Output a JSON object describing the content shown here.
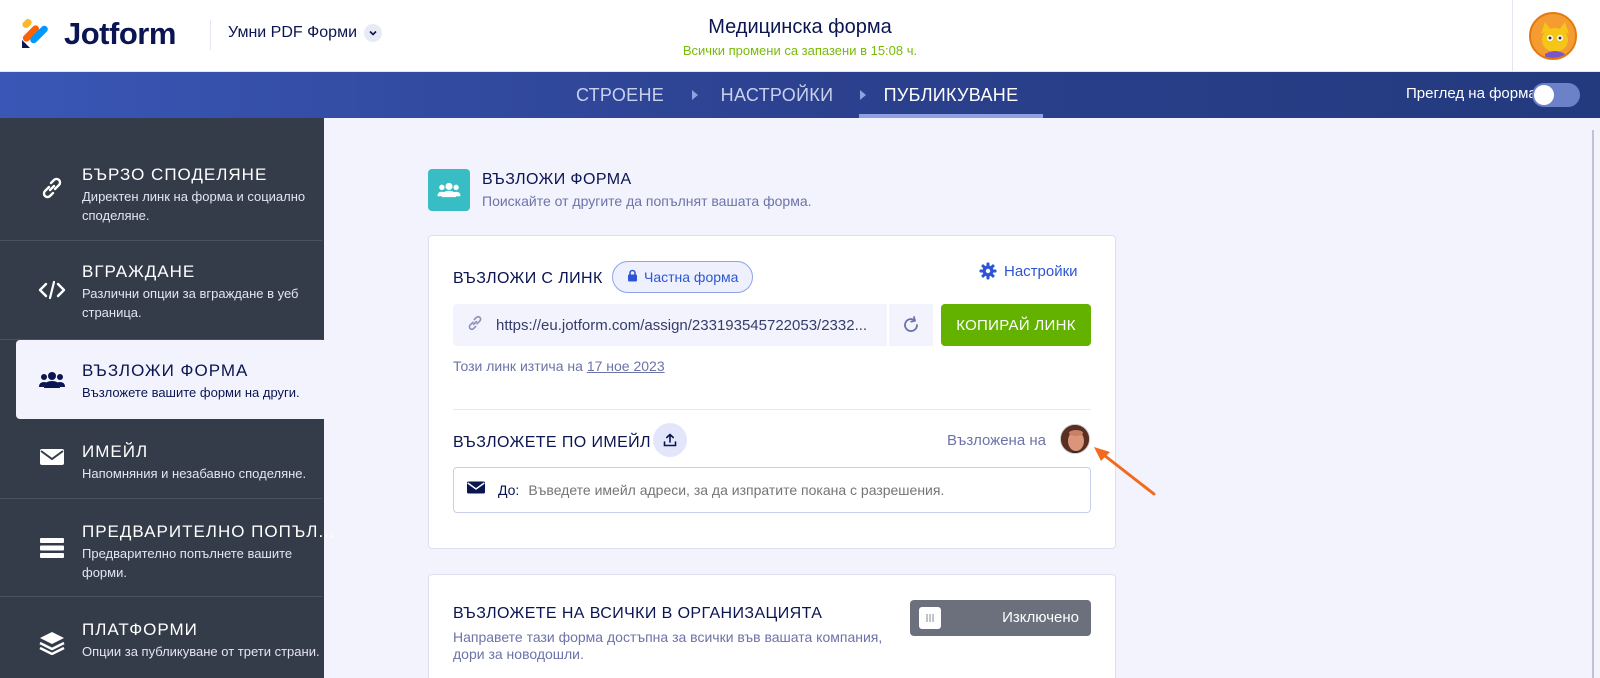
{
  "header": {
    "logo_text": "Jotform",
    "product_label": "Умни PDF Форми",
    "form_title": "Медицинска форма",
    "save_status": "Всички промени са запазени в 15:08 ч."
  },
  "nav": {
    "tabs": [
      {
        "label": "СТРОЕНЕ",
        "active": false
      },
      {
        "label": "НАСТРОЙКИ",
        "active": false
      },
      {
        "label": "ПУБЛИКУВАНЕ",
        "active": true
      }
    ],
    "preview_label": "Преглед на форма",
    "preview_on": false
  },
  "sidebar": {
    "items": [
      {
        "title": "БЪРЗО СПОДЕЛЯНЕ",
        "desc": "Директен линк на форма и социално споделяне.",
        "icon": "link-icon",
        "active": false
      },
      {
        "title": "ВГРАЖДАНЕ",
        "desc": "Различни опции за вграждане в уеб страница.",
        "icon": "code-icon",
        "active": false
      },
      {
        "title": "ВЪЗЛОЖИ ФОРМА",
        "desc": "Възложете вашите форми на други.",
        "icon": "users-icon",
        "active": true
      },
      {
        "title": "ИМЕЙЛ",
        "desc": "Напомняния и незабавно споделяне.",
        "icon": "envelope-icon",
        "active": false
      },
      {
        "title": "ПРЕДВАРИТЕЛНО ПОПЪЛ...",
        "desc": "Предварително попълнете вашите форми.",
        "icon": "list-icon",
        "active": false
      },
      {
        "title": "ПЛАТФОРМИ",
        "desc": "Опции за публикуване от трети страни.",
        "icon": "layers-icon",
        "active": false
      }
    ]
  },
  "section": {
    "title": "ВЪЗЛОЖИ ФОРМА",
    "subtitle": "Поискайте от другите да попълнят вашата форма."
  },
  "assign_link": {
    "title": "ВЪЗЛОЖИ С ЛИНК",
    "badge": "Частна форма",
    "settings_label": "Настройки",
    "url": "https://eu.jotform.com/assign/233193545722053/2332...",
    "copy_label": "КОПИРАЙ ЛИНК",
    "expire_prefix": "Този линк изтича на",
    "expire_date": "17 ное 2023"
  },
  "assign_email": {
    "title": "ВЪЗЛОЖЕТЕ ПО ИМЕЙЛ",
    "assigned_label": "Възложена на",
    "to_label": "До:",
    "to_placeholder": "Въведете имейл адреси, за да изпратите покана с разрешения."
  },
  "assign_org": {
    "title": "ВЪЗЛОЖЕТЕ НА ВСИЧКИ В ОРГАНИЗАЦИЯТА",
    "desc": "Направете тази форма достъпна за всички във вашата компания, дори за новодошли.",
    "toggle_label": "Изключено",
    "enabled": false
  },
  "colors": {
    "accent_green": "#64b200",
    "accent_blue": "#2c55d6",
    "sidebar_bg": "#343c4a",
    "annotation_arrow": "#f26a1b"
  }
}
